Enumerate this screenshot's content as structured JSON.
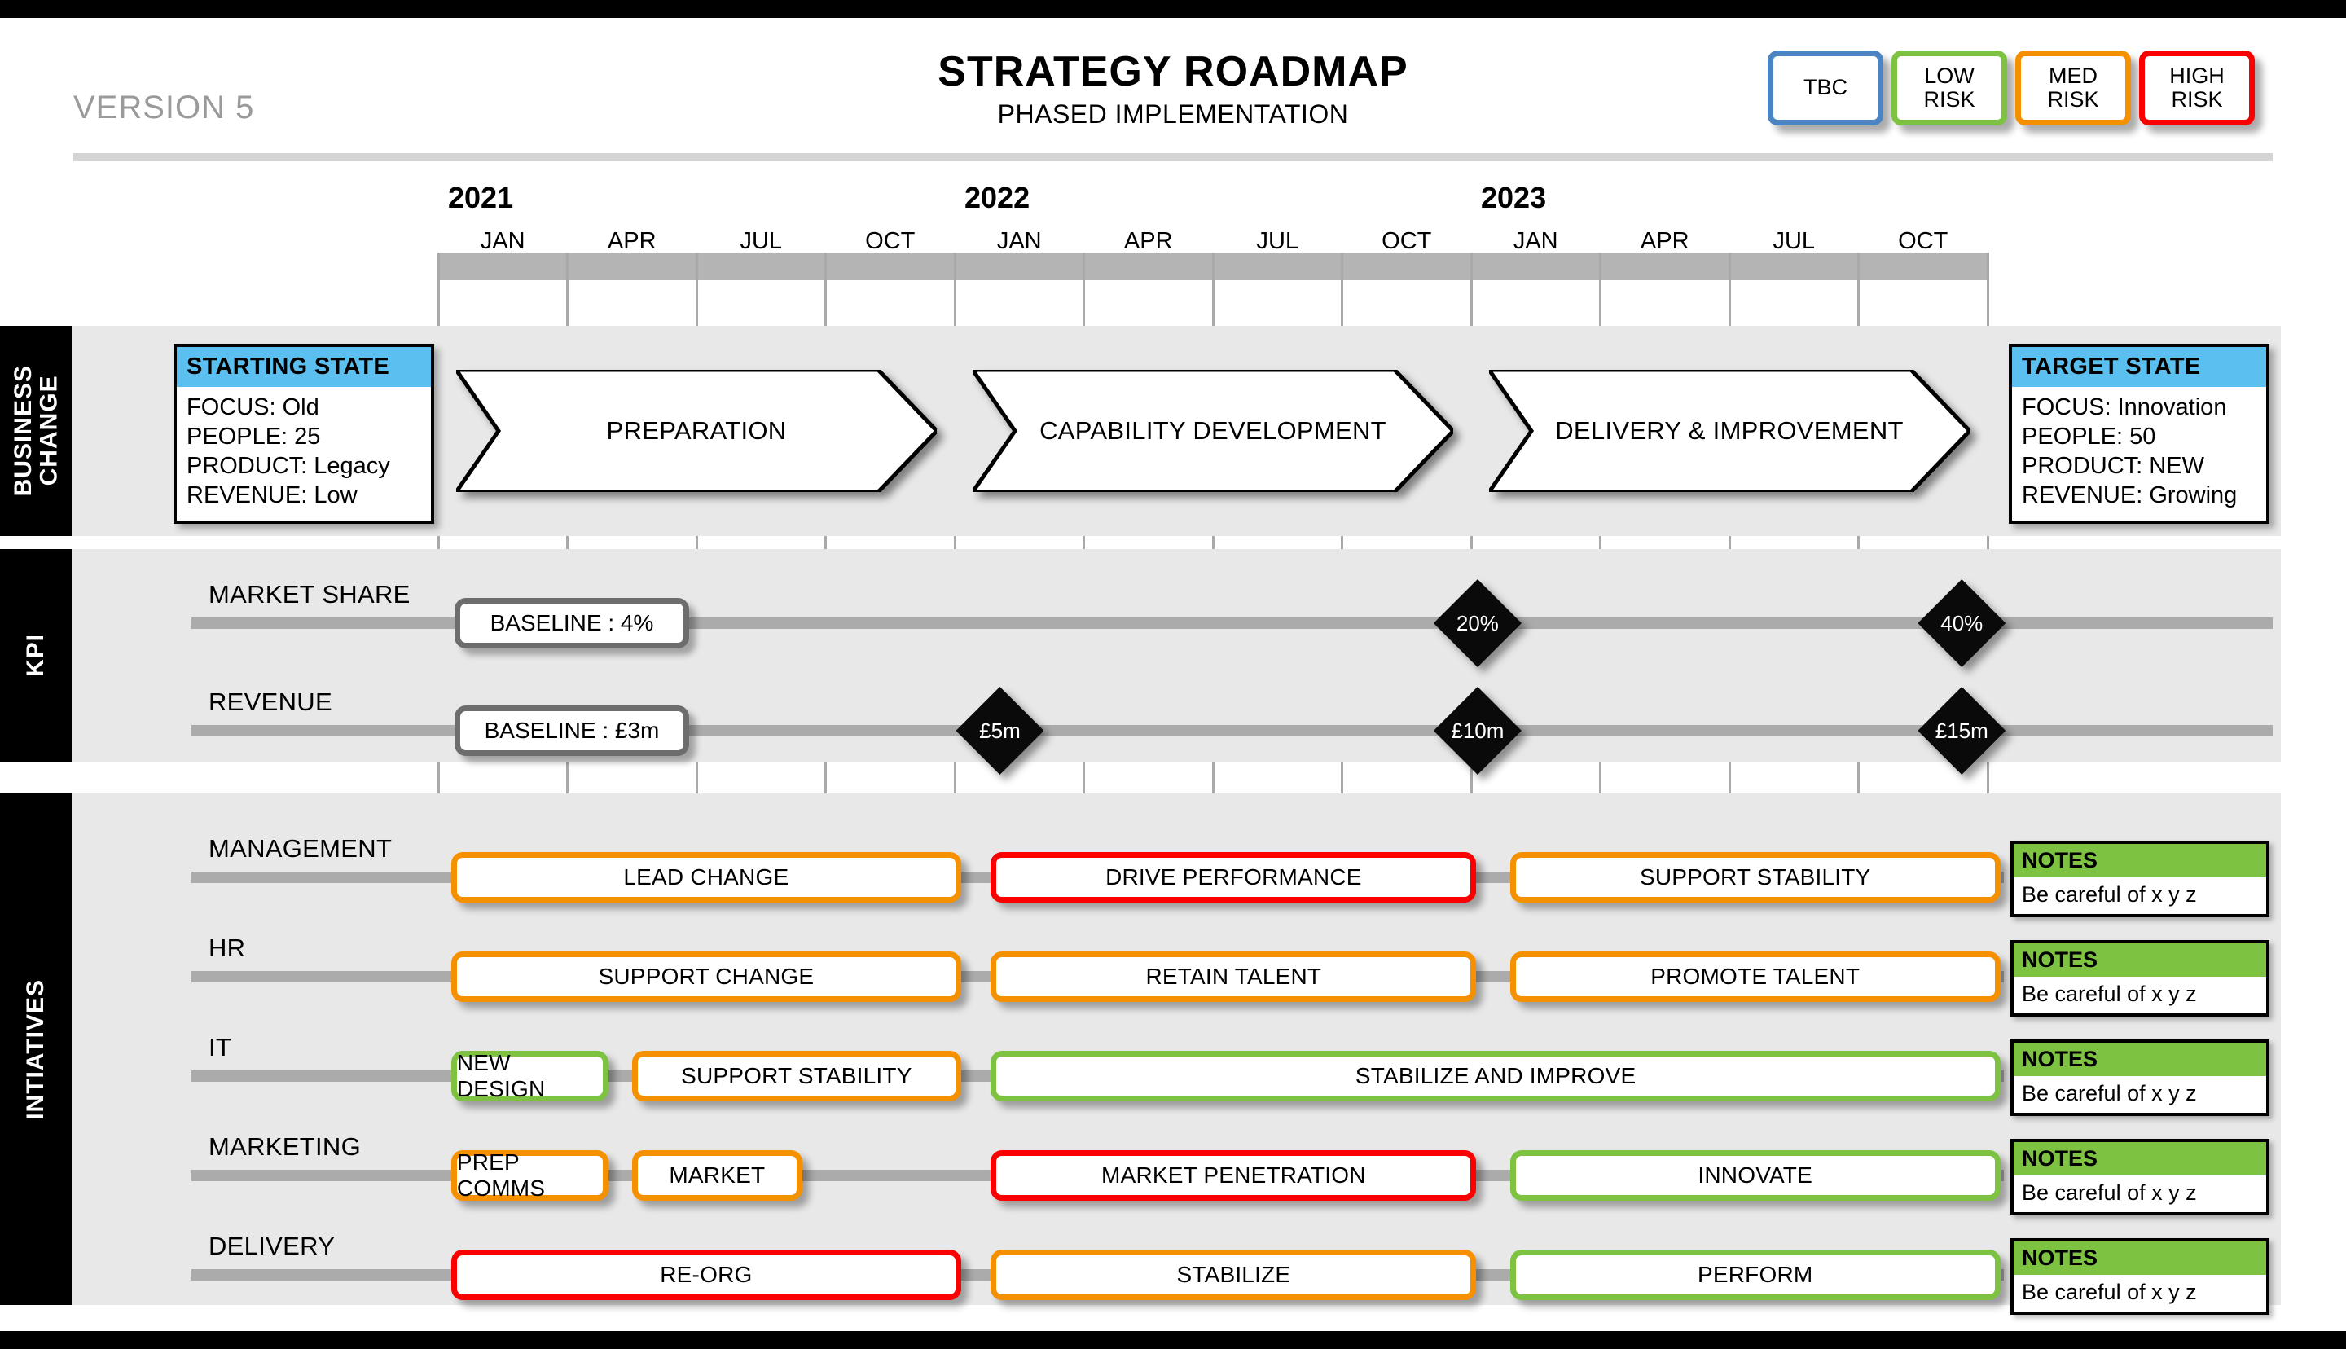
{
  "header": {
    "version": "VERSION 5",
    "title": "STRATEGY ROADMAP",
    "subtitle": "PHASED IMPLEMENTATION"
  },
  "legend": {
    "items": [
      {
        "label": "TBC",
        "color": "#4a84c4"
      },
      {
        "label": "LOW\nRISK",
        "color": "#7ec242"
      },
      {
        "label": "MED\nRISK",
        "color": "#f59100"
      },
      {
        "label": "HIGH\nRISK",
        "color": "#fa0000"
      }
    ]
  },
  "timeline": {
    "years": [
      "2021",
      "2022",
      "2023"
    ],
    "months": [
      "JAN",
      "APR",
      "JUL",
      "OCT",
      "JAN",
      "APR",
      "JUL",
      "OCT",
      "JAN",
      "APR",
      "JUL",
      "OCT"
    ]
  },
  "bands": {
    "business_change": {
      "label": "BUSINESS\nCHANGE",
      "starting_state": {
        "title": "STARTING STATE",
        "lines": [
          "FOCUS: Old",
          "PEOPLE: 25",
          "PRODUCT: Legacy",
          "REVENUE: Low"
        ]
      },
      "target_state": {
        "title": "TARGET STATE",
        "lines": [
          "FOCUS: Innovation",
          "PEOPLE: 50",
          "PRODUCT: NEW",
          "REVENUE: Growing"
        ]
      },
      "phases": [
        {
          "label": "PREPARATION",
          "start": 0,
          "span": 4
        },
        {
          "label": "CAPABILITY DEVELOPMENT",
          "start": 4,
          "span": 4
        },
        {
          "label": "DELIVERY & IMPROVEMENT",
          "start": 8,
          "span": 4
        }
      ]
    },
    "kpi": {
      "label": "KPI",
      "rows": [
        {
          "label": "MARKET SHARE",
          "baseline": "BASELINE : 4%",
          "milestones": [
            {
              "value": "20%",
              "q": 8.05
            },
            {
              "value": "40%",
              "q": 11.8
            }
          ]
        },
        {
          "label": "REVENUE",
          "baseline": "BASELINE : £3m",
          "milestones": [
            {
              "value": "£5m",
              "q": 4.35
            },
            {
              "value": "£10m",
              "q": 8.05
            },
            {
              "value": "£15m",
              "q": 11.8
            }
          ]
        }
      ]
    },
    "initiatives": {
      "label": "INTIATIVES",
      "note_title": "NOTES",
      "rows": [
        {
          "label": "MANAGEMENT",
          "note": "Be careful of x y z",
          "bars": [
            {
              "label": "LEAD CHANGE",
              "start": 0.1,
              "span": 3.95,
              "risk": "MED"
            },
            {
              "label": "DRIVE PERFORMANCE",
              "start": 4.28,
              "span": 3.76,
              "risk": "HIGH"
            },
            {
              "label": "SUPPORT STABILITY",
              "start": 8.3,
              "span": 3.8,
              "risk": "MED"
            }
          ]
        },
        {
          "label": "HR",
          "note": "Be careful of x y z",
          "bars": [
            {
              "label": "SUPPORT CHANGE",
              "start": 0.1,
              "span": 3.95,
              "risk": "MED"
            },
            {
              "label": "RETAIN TALENT",
              "start": 4.28,
              "span": 3.76,
              "risk": "MED"
            },
            {
              "label": "PROMOTE TALENT",
              "start": 8.3,
              "span": 3.8,
              "risk": "MED"
            }
          ]
        },
        {
          "label": "IT",
          "note": "Be careful of x y z",
          "bars": [
            {
              "label": "NEW DESIGN",
              "start": 0.1,
              "span": 1.22,
              "risk": "LOW"
            },
            {
              "label": "SUPPORT STABILITY",
              "start": 1.5,
              "span": 2.55,
              "risk": "MED"
            },
            {
              "label": "STABILIZE AND IMPROVE",
              "start": 4.28,
              "span": 7.82,
              "risk": "LOW"
            }
          ]
        },
        {
          "label": "MARKETING",
          "note": "Be careful of x y z",
          "bars": [
            {
              "label": "PREP COMMS",
              "start": 0.1,
              "span": 1.22,
              "risk": "MED"
            },
            {
              "label": "MARKET",
              "start": 1.5,
              "span": 1.32,
              "risk": "MED"
            },
            {
              "label": "MARKET PENETRATION",
              "start": 4.28,
              "span": 3.76,
              "risk": "HIGH"
            },
            {
              "label": "INNOVATE",
              "start": 8.3,
              "span": 3.8,
              "risk": "LOW"
            }
          ]
        },
        {
          "label": "DELIVERY",
          "note": "Be careful of x y z",
          "bars": [
            {
              "label": "RE-ORG",
              "start": 0.1,
              "span": 3.95,
              "risk": "HIGH"
            },
            {
              "label": "STABILIZE",
              "start": 4.28,
              "span": 3.76,
              "risk": "MED"
            },
            {
              "label": "PERFORM",
              "start": 8.3,
              "span": 3.8,
              "risk": "LOW"
            }
          ]
        }
      ]
    }
  },
  "colors": {
    "TBC": "#4a84c4",
    "LOW": "#7ec242",
    "MED": "#f59100",
    "HIGH": "#fa0000",
    "band_bg": "#e8e8e8",
    "track": "#ababab",
    "timeline_bar": "#b4b4b4",
    "state_header": "#5bc0ef",
    "note_header": "#7ec242"
  }
}
